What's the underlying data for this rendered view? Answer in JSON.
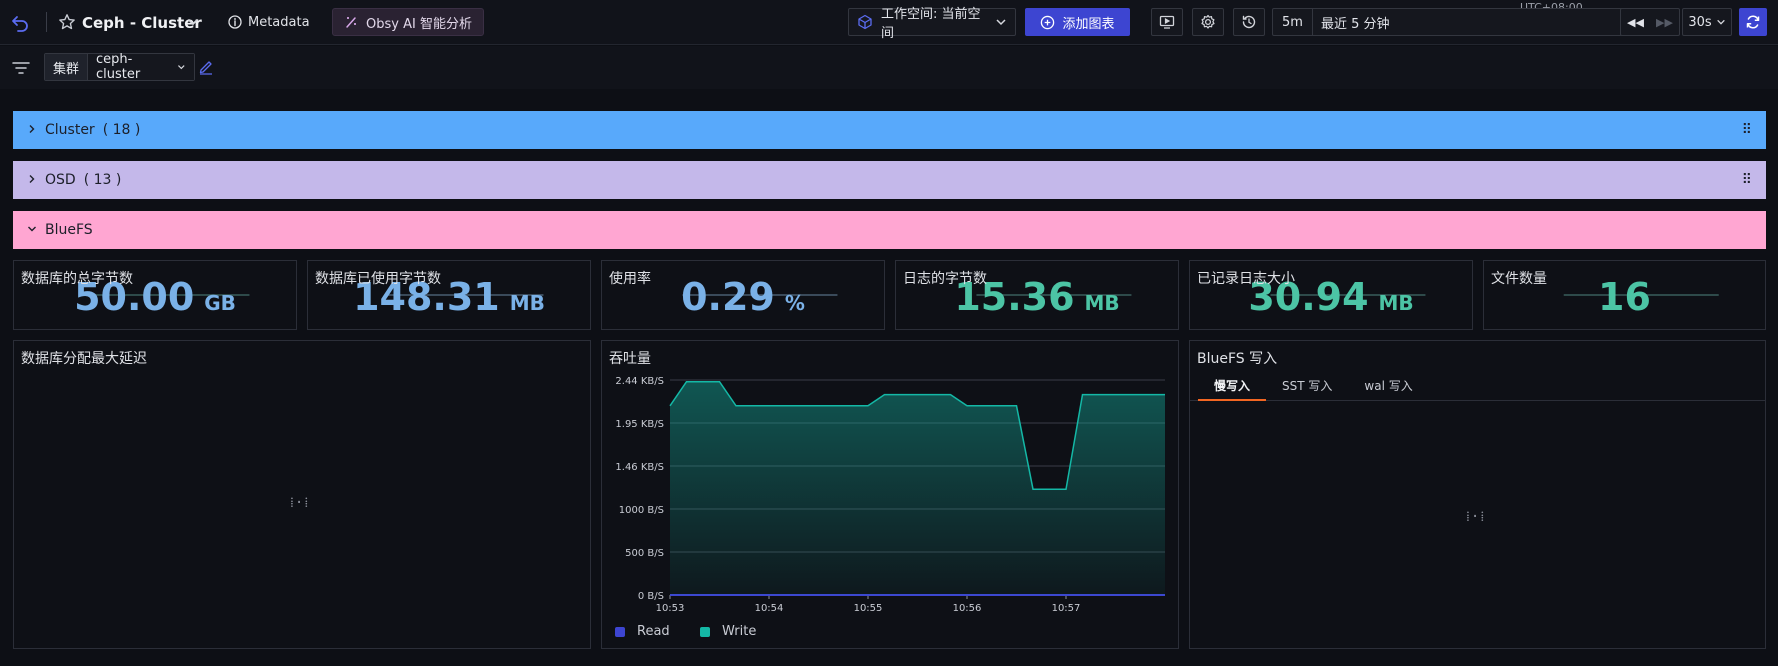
{
  "header": {
    "title": "Ceph - Cluster",
    "metadata_label": "Metadata",
    "ai_label": "Obsy AI 智能分析",
    "workspace_label": "工作空间: 当前空间",
    "add_chart_label": "添加图表",
    "timezone": "UTC+08:00",
    "range_short": "5m",
    "range_long": "最近 5 分钟",
    "refresh_interval": "30s"
  },
  "variables": [
    {
      "label": "集群",
      "value": "ceph-cluster"
    }
  ],
  "rows": [
    {
      "title": "Cluster",
      "count": "( 18 )",
      "color": "#58a9fb",
      "collapsed": true
    },
    {
      "title": "OSD",
      "count": "( 13 )",
      "color": "#c4b8ea",
      "collapsed": true
    },
    {
      "title": "BlueFS",
      "count": "",
      "color": "#ffa6d2",
      "collapsed": false
    }
  ],
  "stats": [
    {
      "title": "数据库的总字节数",
      "value": "50.00",
      "unit": "GB",
      "color": "#7ab1e7"
    },
    {
      "title": "数据库已使用字节数",
      "value": "148.31",
      "unit": "MB",
      "color": "#7ab1e7"
    },
    {
      "title": "使用率",
      "value": "0.29",
      "unit": "%",
      "color": "#7ab1e7"
    },
    {
      "title": "日志的字节数",
      "value": "15.36",
      "unit": "MB",
      "color": "#4cc4a5"
    },
    {
      "title": "已记录日志大小",
      "value": "30.94",
      "unit": "MB",
      "color": "#4cc4a5"
    },
    {
      "title": "文件数量",
      "value": "16",
      "unit": "",
      "color": "#4cc4a5"
    }
  ],
  "panels": {
    "latency": {
      "title": "数据库分配最大延迟",
      "loading": "⁞·⁞"
    },
    "throughput": {
      "title": "吞吐量"
    },
    "writes": {
      "title": "BlueFS 写入",
      "tabs": [
        "慢写入",
        "SST 写入",
        "wal 写入"
      ],
      "active_tab": 0,
      "loading": "⁞·⁞"
    }
  },
  "chart_data": {
    "type": "area",
    "title": "吞吐量",
    "y_ticks": [
      "0 B/S",
      "500 B/S",
      "1000 B/S",
      "1.46 KB/S",
      "1.95 KB/S",
      "2.44 KB/S"
    ],
    "ylim": [
      0,
      2500
    ],
    "x_ticks": [
      "10:53",
      "10:54",
      "10:55",
      "10:56",
      "10:57"
    ],
    "x_tick_values": [
      0,
      60,
      120,
      180,
      240
    ],
    "xlim": [
      0,
      300
    ],
    "series": [
      {
        "name": "Read",
        "color": "#3d45d1",
        "x": [
          0,
          300
        ],
        "values": [
          0,
          0
        ]
      },
      {
        "name": "Write",
        "color": "#14b8a6",
        "x": [
          0,
          10,
          30,
          40,
          60,
          80,
          100,
          120,
          130,
          150,
          170,
          180,
          190,
          210,
          220,
          240,
          250,
          270,
          300
        ],
        "values": [
          2200,
          2480,
          2480,
          2200,
          2200,
          2200,
          2200,
          2200,
          2330,
          2330,
          2330,
          2200,
          2200,
          2200,
          1230,
          1230,
          2330,
          2330,
          2330
        ]
      }
    ]
  }
}
